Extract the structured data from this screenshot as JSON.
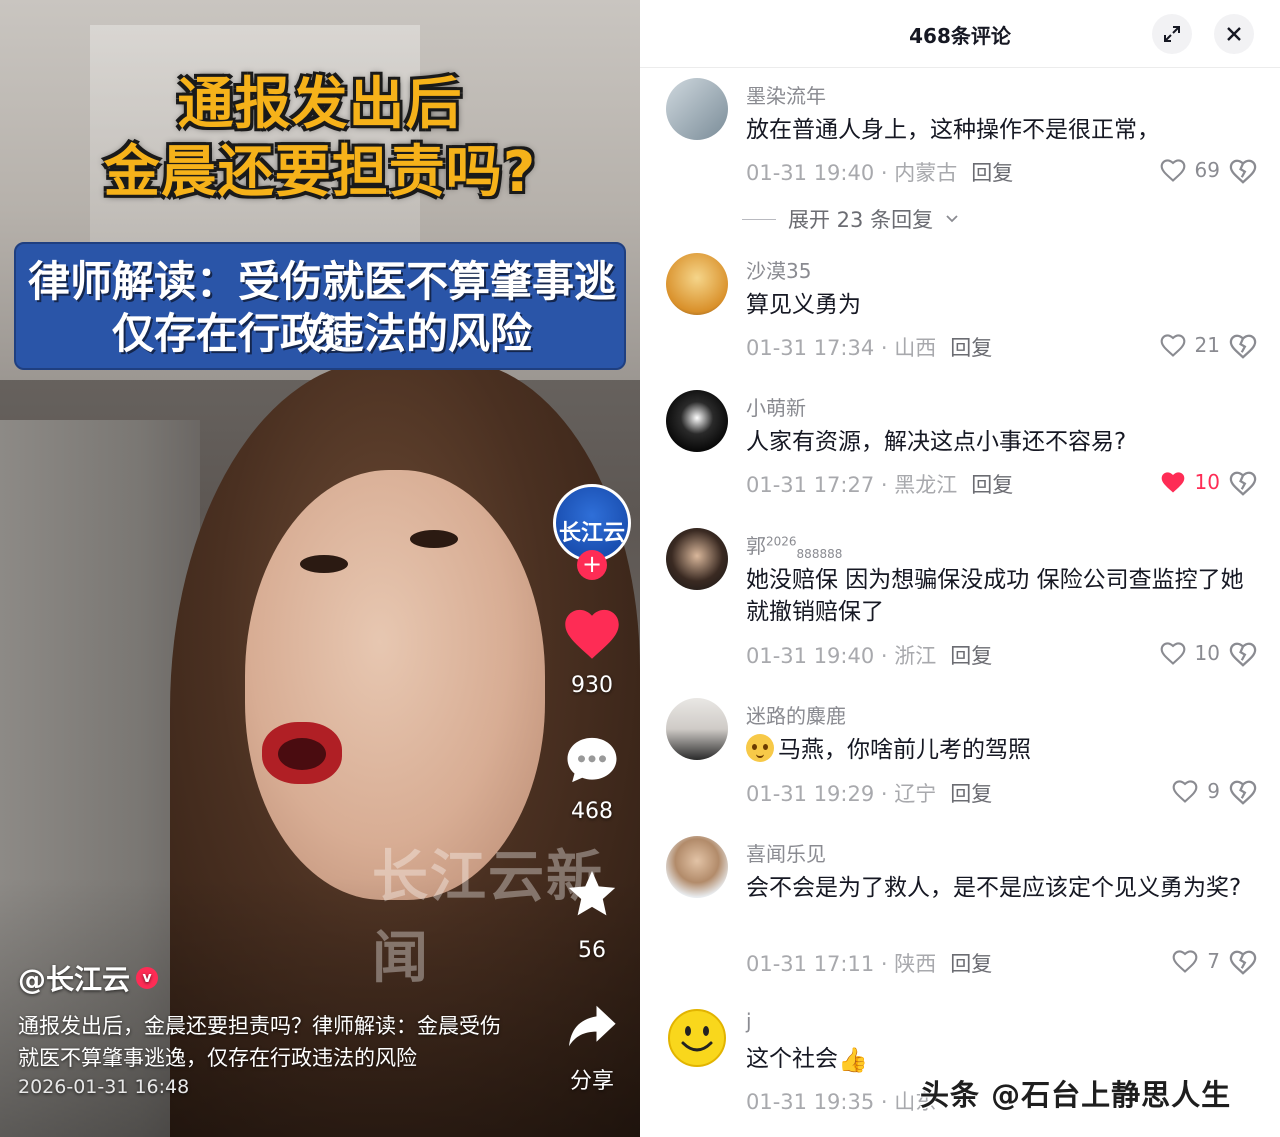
{
  "video": {
    "headline_line1": "通报发出后",
    "headline_line2": "金晨还要担责吗?",
    "banner_line1": "律师解读：受伤就医不算肇事逃逸",
    "banner_line2": "仅存在行政违法的风险",
    "watermark": "长江云新闻",
    "channel_logo_text": "长江云",
    "likes_count": "930",
    "comments_count": "468",
    "favorites_count": "56",
    "share_label": "分享",
    "author": "@长江云",
    "verified_badge": "v",
    "caption": "通报发出后，金晨还要担责吗？律师解读：金晨受伤就医不算肇事逃逸，仅存在行政违法的风险",
    "publish_time": "2026-01-31 16:48"
  },
  "comments_panel": {
    "title": "468条评论",
    "expand_icon": "expand-icon",
    "close_icon": "close-icon",
    "comments": [
      {
        "user": "墨染流年",
        "text": "放在普通人身上，这种操作不是很正常，",
        "time": "01-31 19:40",
        "location": "内蒙古",
        "reply_label": "回复",
        "likes": "69",
        "liked": false,
        "expand_replies": "展开 23 条回复"
      },
      {
        "user": "沙漠35",
        "text": "算见义勇为",
        "time": "01-31 17:34",
        "location": "山西",
        "reply_label": "回复",
        "likes": "21",
        "liked": false
      },
      {
        "user": "小萌新",
        "text": "人家有资源，解决这点小事还不容易?",
        "time": "01-31 17:27",
        "location": "黑龙江",
        "reply_label": "回复",
        "likes": "10",
        "liked": true
      },
      {
        "user": "郭",
        "user_sup": "2026",
        "user_sub": "888888",
        "text": "她没赔保 因为想骗保没成功 保险公司查监控了她就撤销赔保了",
        "time": "01-31 19:40",
        "location": "浙江",
        "reply_label": "回复",
        "likes": "10",
        "liked": false
      },
      {
        "user": "迷路的麋鹿",
        "text": "马燕，你啥前儿考的驾照",
        "time": "01-31 19:29",
        "location": "辽宁",
        "reply_label": "回复",
        "likes": "9",
        "liked": false
      },
      {
        "user": "喜闻乐见",
        "text": "会不会是为了救人，是不是应该定个见义勇为奖?",
        "time": "01-31 17:11",
        "location": "陕西",
        "reply_label": "回复",
        "likes": "7",
        "liked": false
      },
      {
        "user": "j",
        "text": "这个社会",
        "time": "01-31 19:35",
        "location": "山东",
        "reply_label": "回复",
        "likes": "",
        "liked": false
      }
    ],
    "meta_separator": " · "
  },
  "watermark_overlay": "头条 @石台上静思人生",
  "colors": {
    "accent_red": "#fe2c55",
    "headline_orange": "#f6b21a",
    "banner_blue": "#2a55a8"
  }
}
